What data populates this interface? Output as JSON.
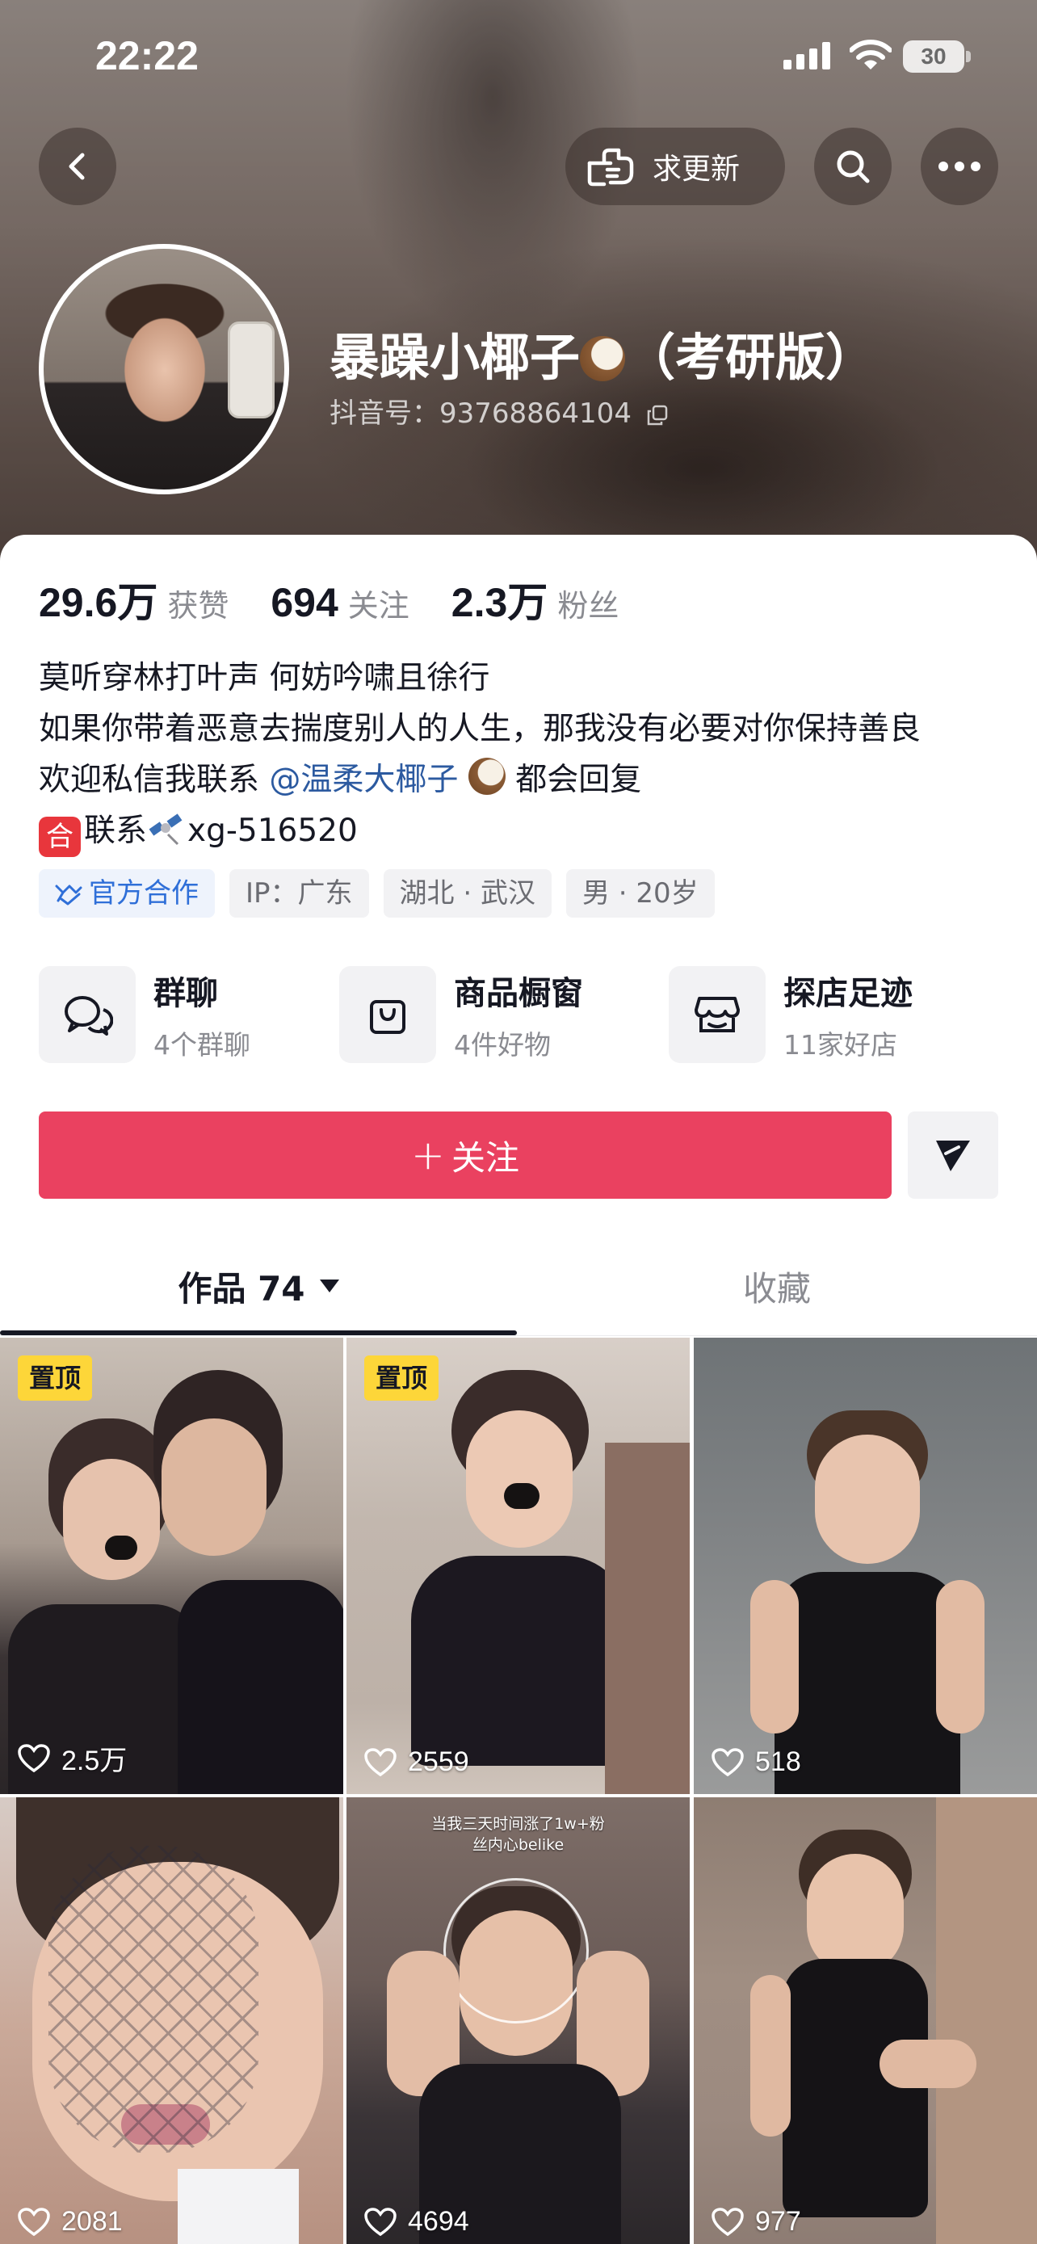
{
  "status": {
    "time": "22:22",
    "battery": "30"
  },
  "header": {
    "update_label": "求更新"
  },
  "profile": {
    "name_prefix": "暴躁小椰子",
    "name_suffix": "（考研版）",
    "douyin_id": "抖音号：93768864104"
  },
  "stats": [
    {
      "value": "29.6万",
      "label": "获赞"
    },
    {
      "value": "694",
      "label": "关注"
    },
    {
      "value": "2.3万",
      "label": "粉丝"
    }
  ],
  "bio": {
    "line1": "莫听穿林打叶声 何妨吟啸且徐行",
    "line2": "如果你带着恶意去揣度别人的人生，那我没有必要对你保持善良",
    "line3_prefix": "欢迎私信我联系",
    "line3_mention": "@温柔大椰子",
    "line3_suffix": "都会回复",
    "line4_badge": "合",
    "line4_prefix": "联系",
    "line4_suffix": "xg-516520"
  },
  "tags": [
    "官方合作",
    "IP：广东",
    "湖北 · 武汉",
    "男 · 20岁"
  ],
  "services": [
    {
      "title": "群聊",
      "sub": "4个群聊",
      "icon": "chat-bubbles-icon"
    },
    {
      "title": "商品橱窗",
      "sub": "4件好物",
      "icon": "shopping-bag-icon"
    },
    {
      "title": "探店足迹",
      "sub": "11家好店",
      "icon": "store-icon"
    }
  ],
  "actions": {
    "follow_label": "关注"
  },
  "tabs": {
    "works": "作品 74",
    "favorites": "收藏"
  },
  "videos": [
    {
      "likes": "2.5万",
      "pinned": "置顶"
    },
    {
      "likes": "2559",
      "pinned": "置顶"
    },
    {
      "likes": "518"
    },
    {
      "likes": "2081"
    },
    {
      "likes": "4694",
      "overlay": "当我三天时间涨了1w+粉",
      "overlay2": "丝内心belike"
    },
    {
      "likes": "977"
    }
  ],
  "colors": {
    "accent": "#ea4160",
    "mention": "#2c5aa0",
    "pin": "#fdd639",
    "official": "#2f6fd8"
  }
}
